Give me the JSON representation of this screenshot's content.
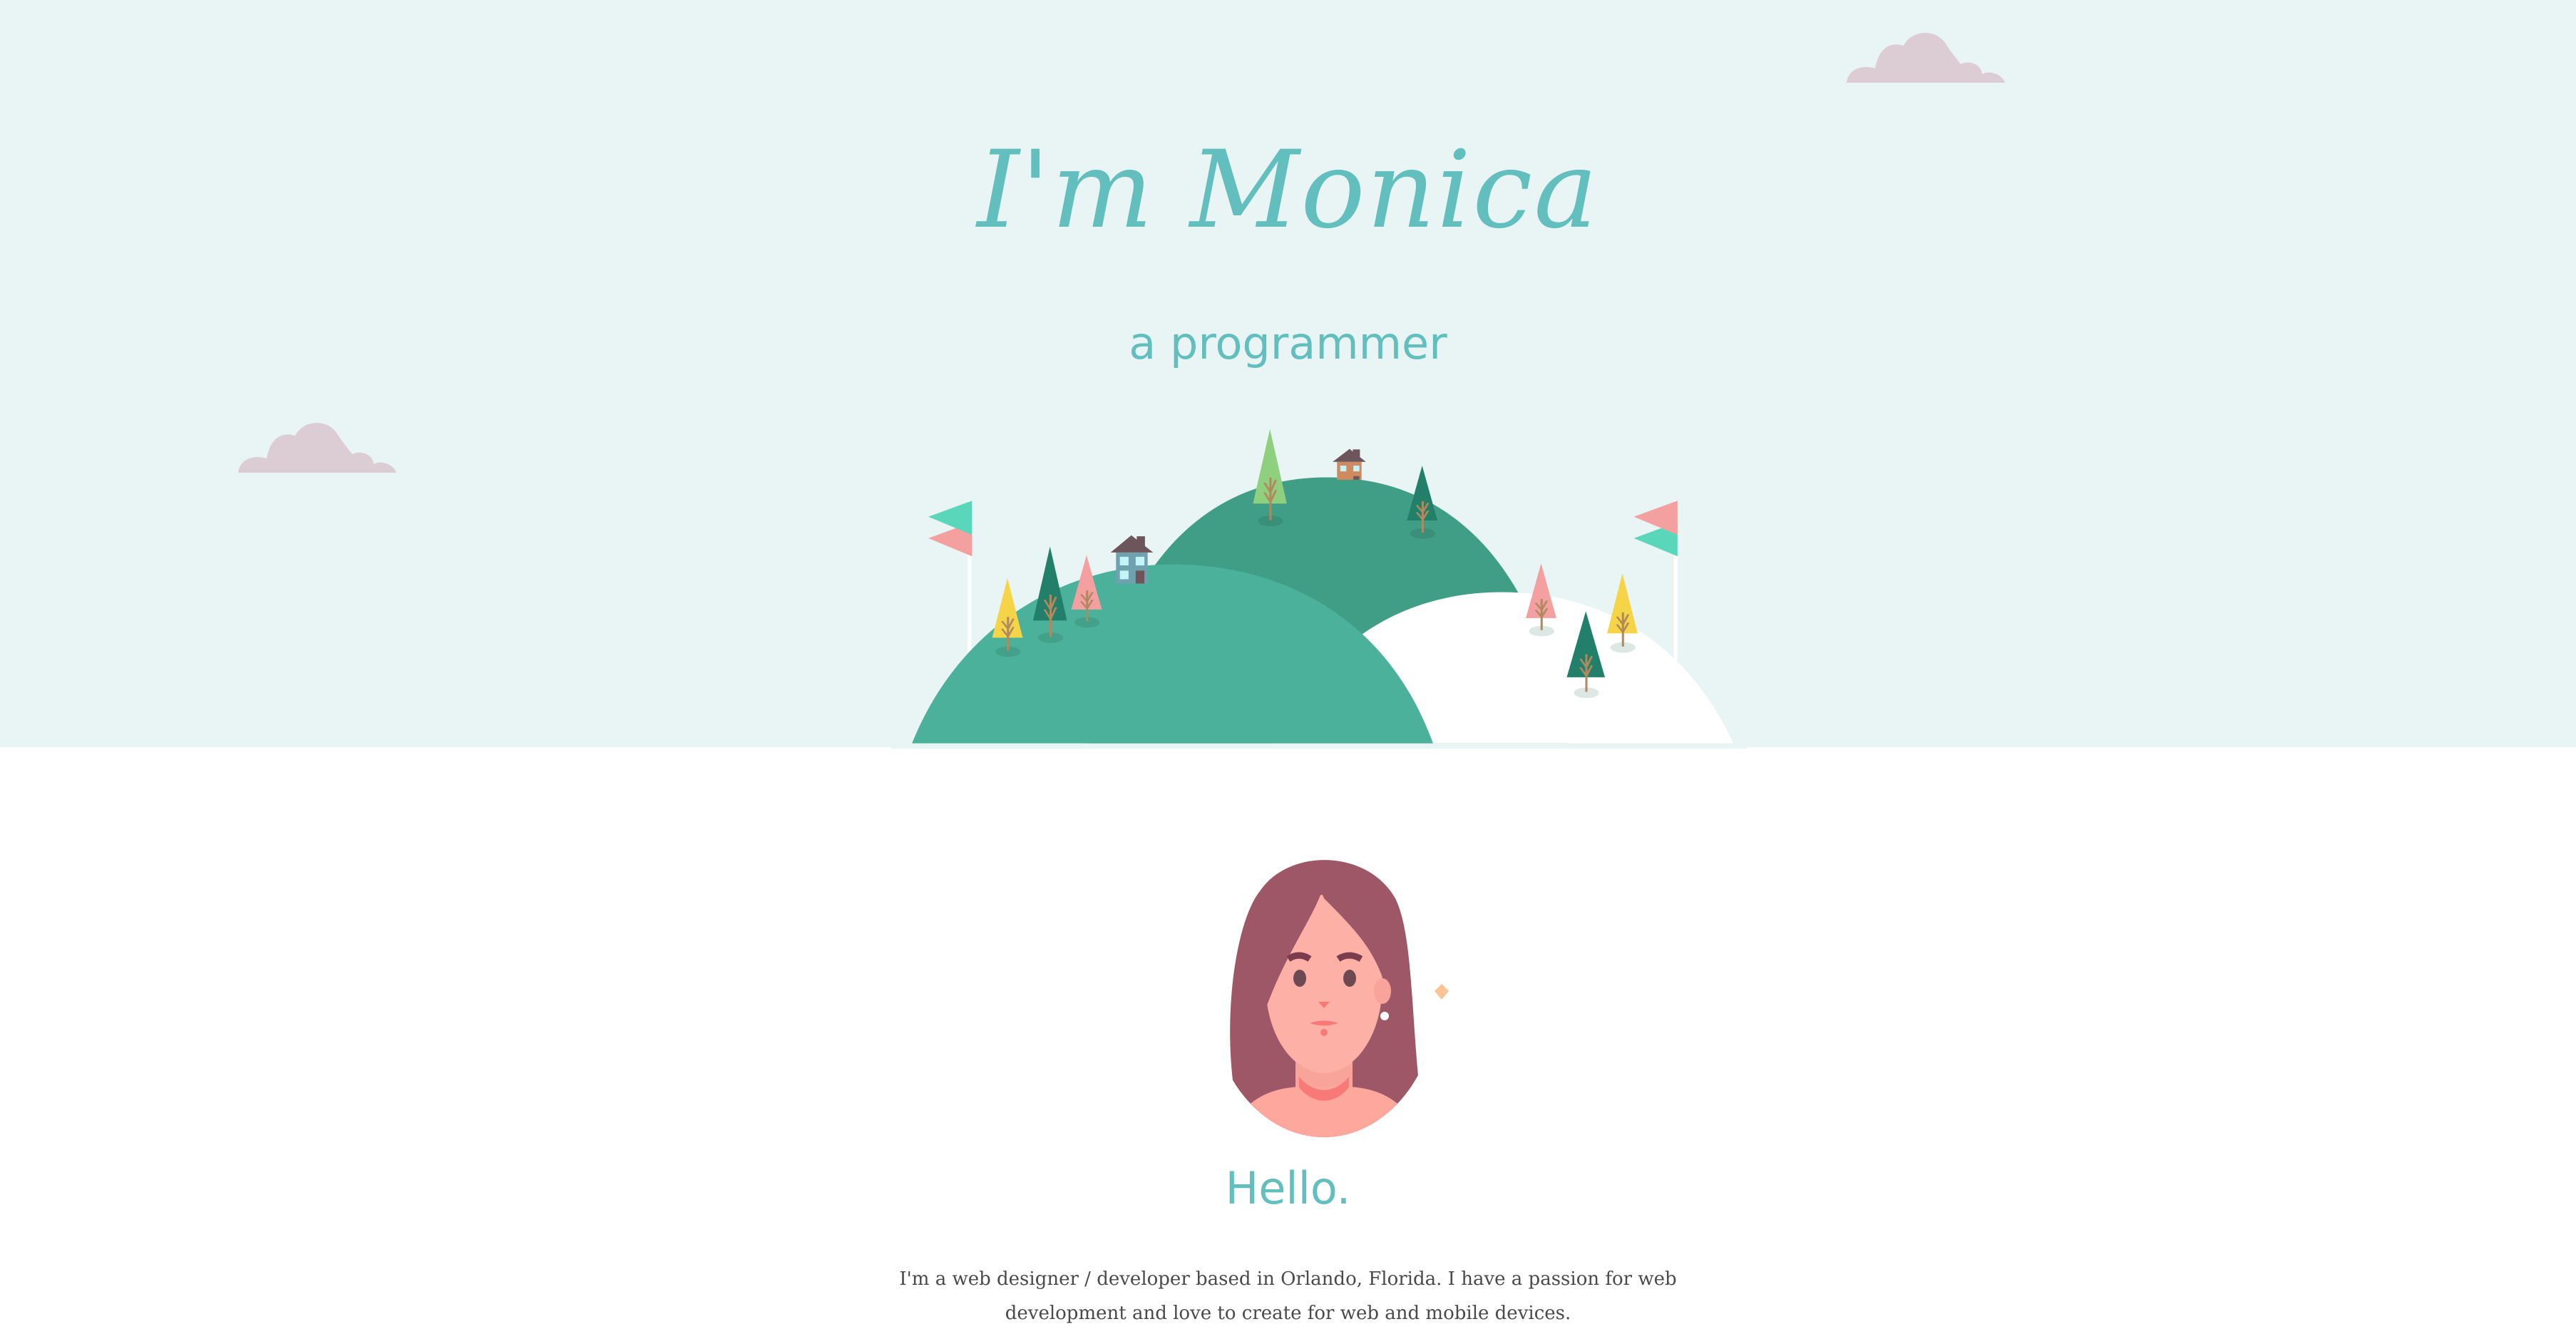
{
  "hero": {
    "title": "I'm Monica",
    "subtitle": "a programmer"
  },
  "about": {
    "heading": "Hello.",
    "bio": "I'm a web designer / developer based in Orlando, Florida. I have a passion for web development and love to create for web and mobile devices."
  },
  "colors": {
    "sky": "#e9f5f4",
    "accent": "#62bfbd",
    "hill_back": "#409e87",
    "hill_front": "#4cb19a",
    "cloud": "#dbcdd3",
    "text": "#4a4a4a"
  }
}
